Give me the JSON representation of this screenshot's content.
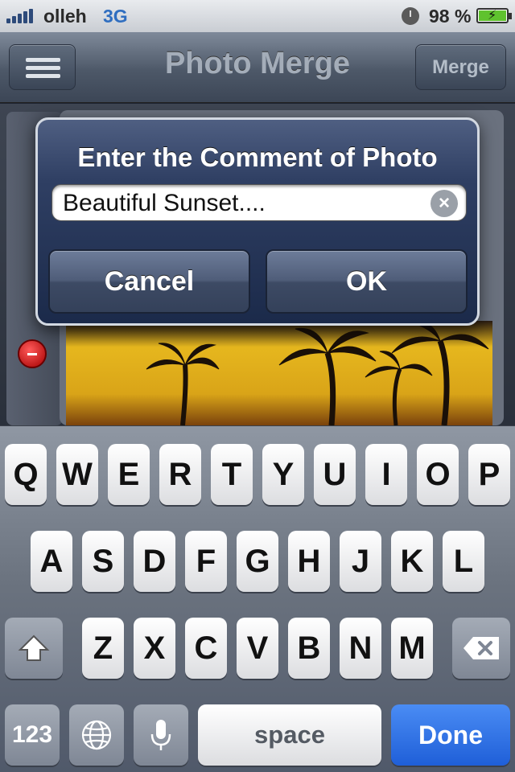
{
  "status_bar": {
    "carrier": "olleh",
    "network": "3G",
    "battery_percent": "98 %"
  },
  "nav_bar": {
    "title": "Photo Merge",
    "merge_label": "Merge"
  },
  "alert": {
    "title": "Enter the Comment of Photo",
    "input_value": "Beautiful Sunset....",
    "cancel_label": "Cancel",
    "ok_label": "OK"
  },
  "keyboard": {
    "row1": [
      "Q",
      "W",
      "E",
      "R",
      "T",
      "Y",
      "U",
      "I",
      "O",
      "P"
    ],
    "row2": [
      "A",
      "S",
      "D",
      "F",
      "G",
      "H",
      "J",
      "K",
      "L"
    ],
    "row3": [
      "Z",
      "X",
      "C",
      "V",
      "B",
      "N",
      "M"
    ],
    "numbers_label": "123",
    "space_label": "space",
    "done_label": "Done"
  },
  "icons": [
    "signal-bars-icon",
    "clock-icon",
    "battery-charging-icon",
    "hamburger-menu-icon",
    "clear-text-icon",
    "delete-circle-icon",
    "shift-icon",
    "backspace-icon",
    "globe-icon",
    "microphone-icon"
  ],
  "colors": {
    "done_key": "#1f5fd8",
    "delete_red": "#d10000"
  }
}
